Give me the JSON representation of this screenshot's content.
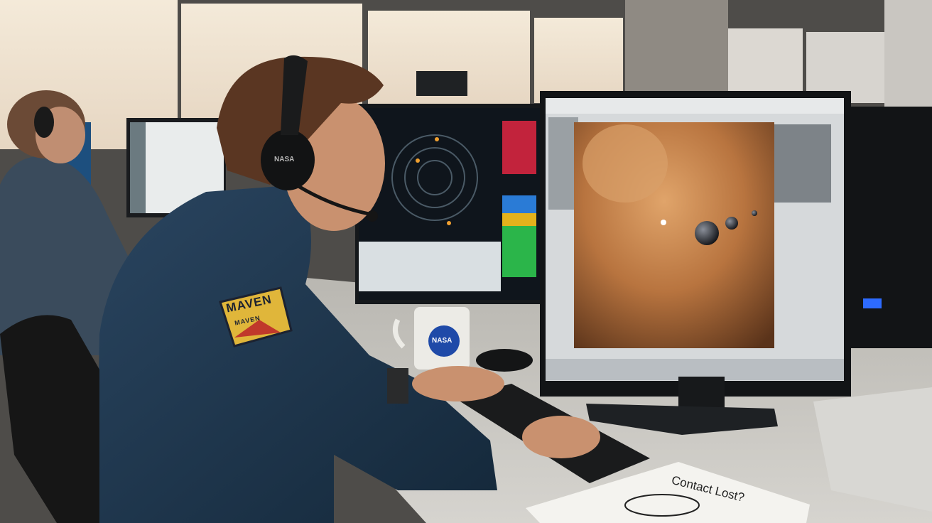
{
  "scene": {
    "subject": "mission-control-operator",
    "colors": {
      "window_light": "#f2e6d6",
      "wall": "#4a4845",
      "desk": "#c9c8c3",
      "jacket": "#1f3448",
      "space_image": "#b87a45",
      "screen_dark": "#0f151c"
    }
  },
  "texts": {
    "patch_line1": "MAVEN",
    "patch_line2": "MAVEN",
    "headset_logo": "NASA",
    "mug_logo": "NASA",
    "note": "Contact Lost?"
  }
}
